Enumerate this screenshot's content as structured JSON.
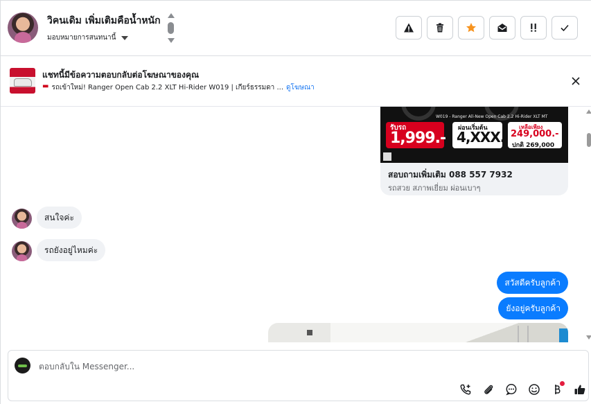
{
  "header": {
    "contact_name": "วิคนเดิม เพิ่มเติมคือน้ำหนัก",
    "assign_label": "มอบหมายการสนทนานี้",
    "actions": [
      "spam",
      "delete",
      "star",
      "mark-unread",
      "follow-up",
      "done"
    ]
  },
  "ad_bar": {
    "title": "แชทนี้มีข้อความตอบกลับต่อโฆษณาของคุณ",
    "subtitle": "รถเข้าใหม่! Ranger Open Cab 2.2 XLT Hi-Rider W019 | เกียร์ธรรมดา ...",
    "link": "ดูโฆษณา"
  },
  "ad_card": {
    "model_line": "W019 - Ranger All-New Open Cab 2.2 Hi-Rider XLT MT",
    "price_label": "รับรถ",
    "price_value": "1,999.-",
    "down_label": "ผ่อนเริ่มต้น",
    "down_value": "4,XXX.-",
    "remain_label": "เหลือเพียง",
    "remain_value": "249,000.-",
    "normal_price": "ปกติ 269,000",
    "title": "สอบถามเพิ่มเติม 088 557 7932",
    "subtitle": "รถสวย สภาพเยี่ยม ผ่อนเบาๆ"
  },
  "messages": [
    {
      "direction": "in",
      "text": "สนใจค่ะ"
    },
    {
      "direction": "in",
      "text": "รถยังอยู่ไหมค่ะ"
    },
    {
      "direction": "out",
      "text": "สวัสดีครับลูกค้า"
    },
    {
      "direction": "out",
      "text": "ยังอยู่ครับลูกค้า"
    }
  ],
  "composer": {
    "placeholder": "ตอบกลับใน Messenger...",
    "tools": [
      "call-add-icon",
      "attach-icon",
      "saved-reply-icon",
      "emoji-icon",
      "baht-icon",
      "like-icon"
    ]
  },
  "colors": {
    "outgoing_bubble": "#0a7cff",
    "incoming_bubble": "#f0f2f5",
    "star": "#f7931e",
    "link": "#1877f2"
  }
}
